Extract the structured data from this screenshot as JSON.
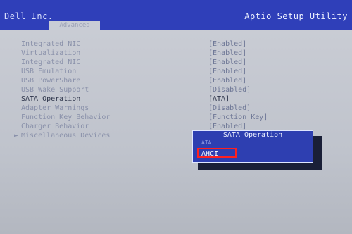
{
  "header": {
    "vendor": "Dell Inc.",
    "utility_title": "Aptio Setup Utility",
    "active_tab": "Advanced"
  },
  "settings": [
    {
      "label": "Integrated NIC",
      "value": "[Enabled]",
      "has_submenu": false
    },
    {
      "label": "Virtualization",
      "value": "[Enabled]",
      "has_submenu": false
    },
    {
      "label": "Integrated NIC",
      "value": "[Enabled]",
      "has_submenu": false
    },
    {
      "label": "USB Emulation",
      "value": "[Enabled]",
      "has_submenu": false
    },
    {
      "label": "USB PowerShare",
      "value": "[Enabled]",
      "has_submenu": false
    },
    {
      "label": "USB Wake Support",
      "value": "[Disabled]",
      "has_submenu": false
    },
    {
      "label": "SATA Operation",
      "value": "[ATA]",
      "has_submenu": false,
      "active": true
    },
    {
      "label": "Adapter Warnings",
      "value": "[Disabled]",
      "has_submenu": false
    },
    {
      "label": "Function Key Behavior",
      "value": "[Function Key]",
      "has_submenu": false
    },
    {
      "label": "Charger Behavior",
      "value": "[Enabled]",
      "has_submenu": false
    },
    {
      "label": "Miscellaneous Devices",
      "value": "",
      "has_submenu": true
    }
  ],
  "submenu_marker": "►",
  "popup": {
    "title": "SATA Operation",
    "options": [
      "ATA",
      "AHCI"
    ],
    "selected": "AHCI"
  },
  "colors": {
    "header_bg": "#2f3fb9",
    "body_bg": "#c9cdd6",
    "popup_bg": "#2e3fb1",
    "highlight_border": "#ff2020"
  }
}
